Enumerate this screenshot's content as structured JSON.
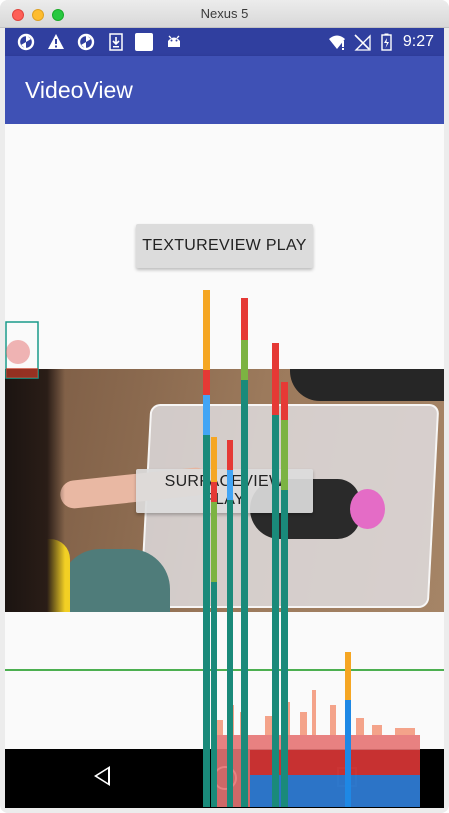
{
  "window": {
    "title": "Nexus 5"
  },
  "status_bar": {
    "time": "9:27",
    "icons": [
      "sync-icon",
      "warning-icon",
      "sync-icon",
      "download-icon",
      "white-square-icon",
      "android-icon",
      "wifi-icon",
      "no-sim-icon",
      "battery-icon"
    ]
  },
  "app_bar": {
    "title": "VideoView"
  },
  "buttons": {
    "textureview_play": "TEXTUREVIEW PLAY",
    "surfaceview_play": "SURFACEVIEW PLAY"
  },
  "colors": {
    "status_bar": "#303f9f",
    "app_bar": "#3f51b5",
    "profile_green_line": "#4caf50"
  }
}
